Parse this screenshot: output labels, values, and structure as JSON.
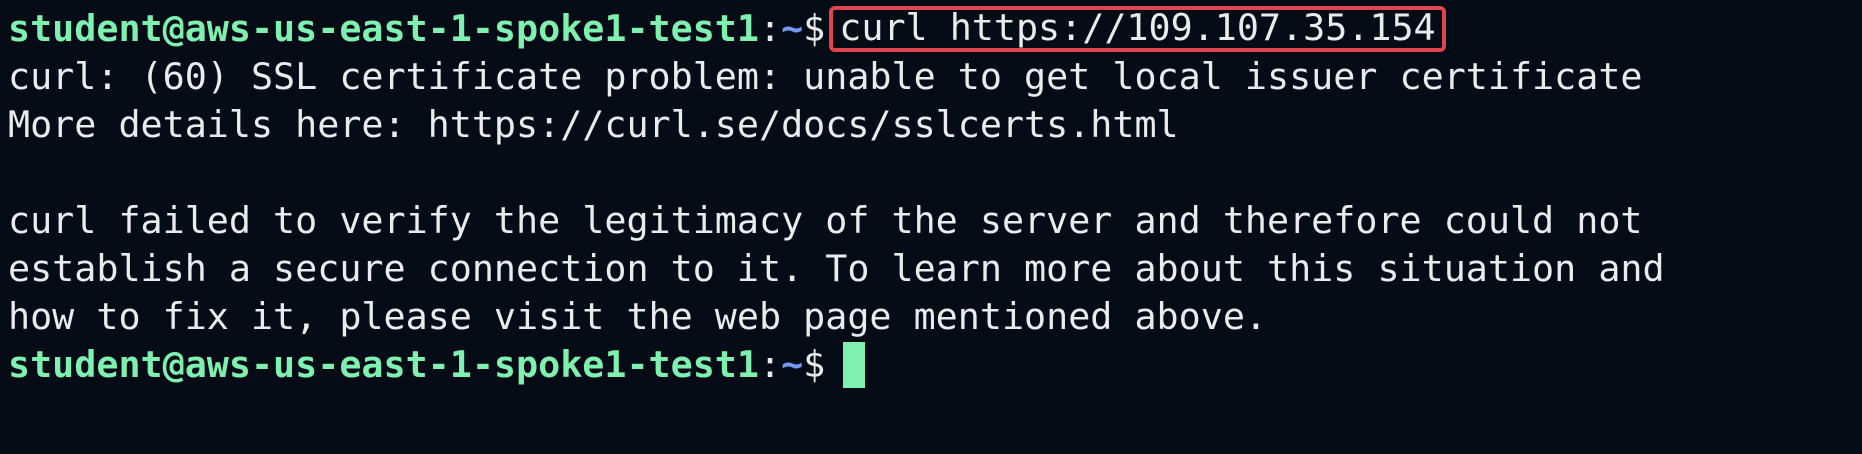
{
  "prompt": {
    "user_host": "student@aws-us-east-1-spoke1-test1",
    "separator": ":",
    "path": "~",
    "symbol": "$"
  },
  "command": "curl https://109.107.35.154",
  "output_lines": [
    "curl: (60) SSL certificate problem: unable to get local issuer certificate",
    "More details here: https://curl.se/docs/sslcerts.html",
    "",
    "curl failed to verify the legitimacy of the server and therefore could not",
    "establish a secure connection to it. To learn more about this situation and",
    "how to fix it, please visit the web page mentioned above."
  ],
  "colors": {
    "background": "#050c16",
    "prompt_user": "#7ff0b0",
    "prompt_path": "#6f9cf0",
    "text": "#e8ecef",
    "highlight_border": "#e0444c",
    "cursor": "#7ff0b0"
  }
}
